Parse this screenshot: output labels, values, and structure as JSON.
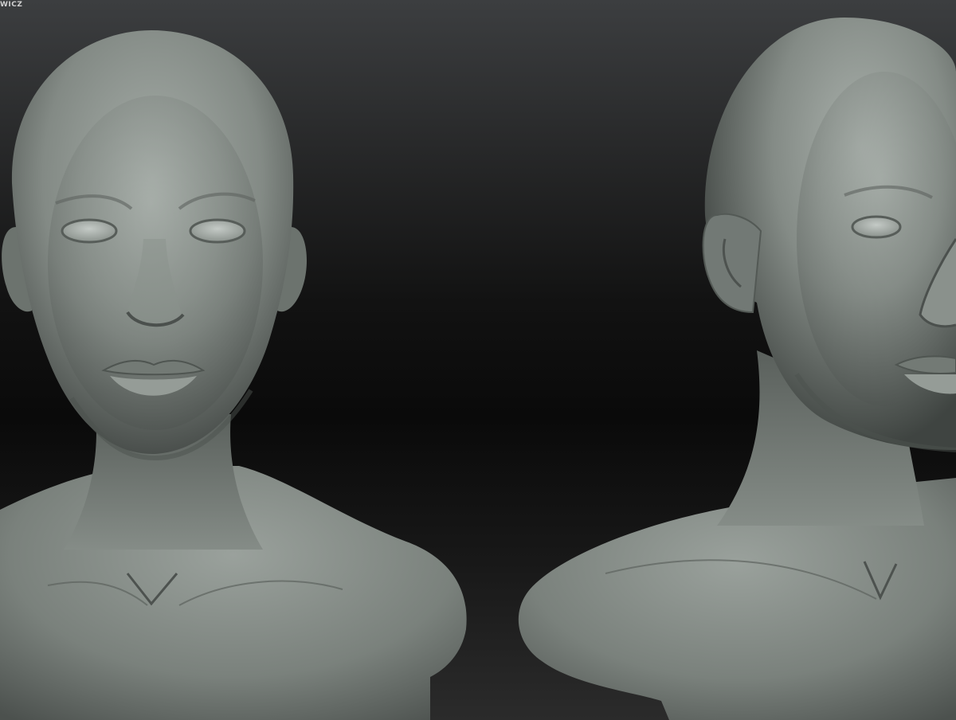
{
  "image": {
    "description_tag": "3d-sculpt-render",
    "watermark_text": "WICZ",
    "colors": {
      "background_top": "#3c3e40",
      "background_mid": "#0a0a0a",
      "clay_base": "#7d8480",
      "clay_highlight": "#aab1ac",
      "clay_shadow": "#3a3e3b"
    }
  }
}
